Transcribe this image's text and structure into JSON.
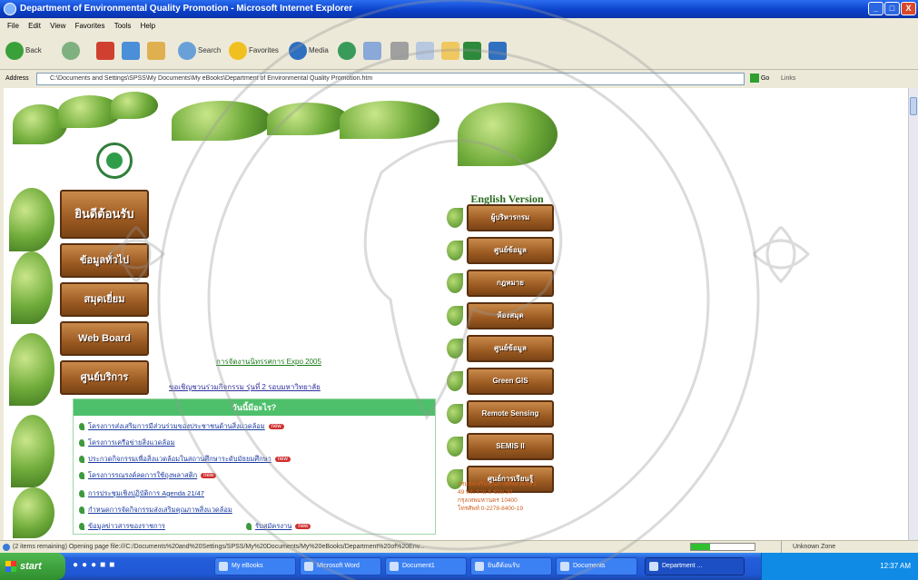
{
  "window": {
    "title": "Department of Environmental Quality Promotion - Microsoft Internet Explorer",
    "minimize": "_",
    "maximize": "□",
    "close": "X"
  },
  "menubar": [
    "File",
    "Edit",
    "View",
    "Favorites",
    "Tools",
    "Help"
  ],
  "toolbar": {
    "back": "Back",
    "search": "Search",
    "favorites": "Favorites",
    "media": "Media"
  },
  "address": {
    "label": "Address",
    "value": "C:\\Documents and Settings\\SPSS\\My Documents\\My eBooks\\Department of Environmental Quality Promotion.htm",
    "go": "Go",
    "links": "Links"
  },
  "page": {
    "left_menu": [
      "ยินดีต้อนรับ",
      "ข้อมูลทั่วไป",
      "สมุดเยี่ยม",
      "Web Board",
      "ศูนย์บริการ"
    ],
    "english_title": "English Version",
    "right_menu": [
      "ผู้บริหารกรม",
      "ศูนย์ข้อมูล",
      "กฎหมาย",
      "ห้องสมุด",
      "ศูนย์ข้อมูล",
      "Green GIS",
      "Remote Sensing",
      "SEMIS II",
      "ศูนย์การเรียนรู้"
    ],
    "expo_link": "การจัดงานนิทรรศการ Expo 2005",
    "sub_line": "ขอเชิญชวนร่วมกิจกรรม รุ่นที่ 2 รอบมหาวิทยาลัย",
    "news_heading": "วันนี้มีอะไร?",
    "news_items": [
      {
        "text": "โครงการส่งเสริมการมีส่วนร่วมของประชาชนด้านสิ่งแวดล้อม",
        "new": true
      },
      {
        "text": "โครงการเครือข่ายสิ่งแวดล้อม",
        "new": false
      },
      {
        "text": "ประกวดกิจกรรมเพื่อสิ่งแวดล้อมในสถานศึกษาระดับมัธยมศึกษา",
        "new": true
      },
      {
        "text": "โครงการรณรงค์ลดการใช้ถุงพลาสติก",
        "new": true
      },
      {
        "text": "การประชุมเชิงปฏิบัติการ Agenda 21/47",
        "new": false
      },
      {
        "text": "กำหนดการจัดกิจกรรมส่งเสริมคุณภาพสิ่งแวดล้อม",
        "new": false
      },
      {
        "text": "ข้อมูลข่าวสารของราชการ",
        "new": false
      }
    ],
    "news_extra": {
      "text": "รับสมัครงาน",
      "new": true
    },
    "new_badge": "new",
    "contact": [
      "กรมส่งเสริมคุณภาพสิ่งแวดล้อม",
      "49 พระราม 6 ซอย 30",
      "กรุงเทพมหานคร 10400",
      "โทรศัพท์ 0-2278-8400-19"
    ]
  },
  "status": {
    "text": "(2 items remaining) Opening page file:///C:/Documents%20and%20Settings/SPSS/My%20Documents/My%20eBooks/Department%20of%20Env...",
    "progress": 0.3,
    "zone": "Unknown Zone"
  },
  "taskbar": {
    "start": "start",
    "tasks": [
      "My eBooks",
      "Microsoft Word",
      "Document1",
      "ยินดีต้อนรับ",
      "Documents",
      "Department ..."
    ],
    "active_index": 5,
    "clock": "12:37 AM"
  }
}
